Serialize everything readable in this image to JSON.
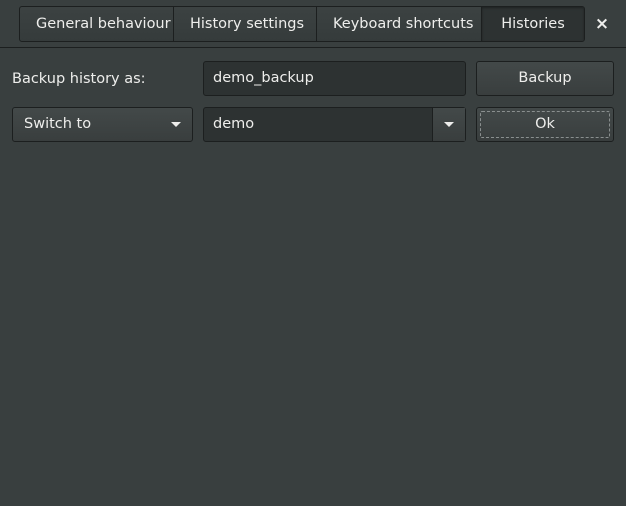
{
  "tabs": [
    {
      "label": "General behaviour",
      "active": false
    },
    {
      "label": "History settings",
      "active": false
    },
    {
      "label": "Keyboard shortcuts",
      "active": false
    },
    {
      "label": "Histories",
      "active": true
    }
  ],
  "close": {
    "icon": "close-icon",
    "glyph": "×"
  },
  "backup_row": {
    "label": "Backup history as:",
    "entry_value": "demo_backup",
    "button_label": "Backup"
  },
  "switch_row": {
    "mode_selected": "Switch to",
    "history_selected": "demo",
    "button_label": "Ok"
  },
  "colors": {
    "background": "#393f3f",
    "entry_background": "#2d3232",
    "border": "#1c1f1f",
    "text": "#eeeeec"
  }
}
